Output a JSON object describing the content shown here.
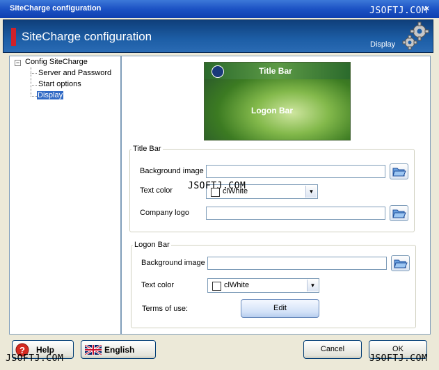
{
  "window": {
    "title": "SiteCharge configuration",
    "close_glyph": "×"
  },
  "watermark": "JSOFTJ.COM",
  "header": {
    "title": "SiteCharge configuration",
    "subtitle": "Display",
    "icon": "gears-icon"
  },
  "tree": {
    "root": "Config SiteCharge",
    "expander": "−",
    "items": [
      "Server and Password",
      "Start options",
      "Display"
    ],
    "selected": "Display"
  },
  "preview": {
    "title_bar": "Title Bar",
    "logon_bar": "Logon Bar"
  },
  "title_bar_group": {
    "legend": "Title Bar",
    "background_image_label": "Background image",
    "background_image_value": "",
    "text_color_label": "Text color",
    "text_color_value": "clWhite",
    "company_logo_label": "Company logo",
    "company_logo_value": ""
  },
  "logon_bar_group": {
    "legend": "Logon Bar",
    "background_image_label": "Background image",
    "background_image_value": "",
    "text_color_label": "Text color",
    "text_color_value": "clWhite",
    "terms_label": "Terms of use:",
    "edit_button": "Edit"
  },
  "footer": {
    "help": "Help",
    "language": "English",
    "cancel": "Cancel",
    "ok": "OK"
  },
  "colors": {
    "accent_red": "#d0222a",
    "header_blue": "#1d5ea6",
    "selection": "#316ac5"
  }
}
